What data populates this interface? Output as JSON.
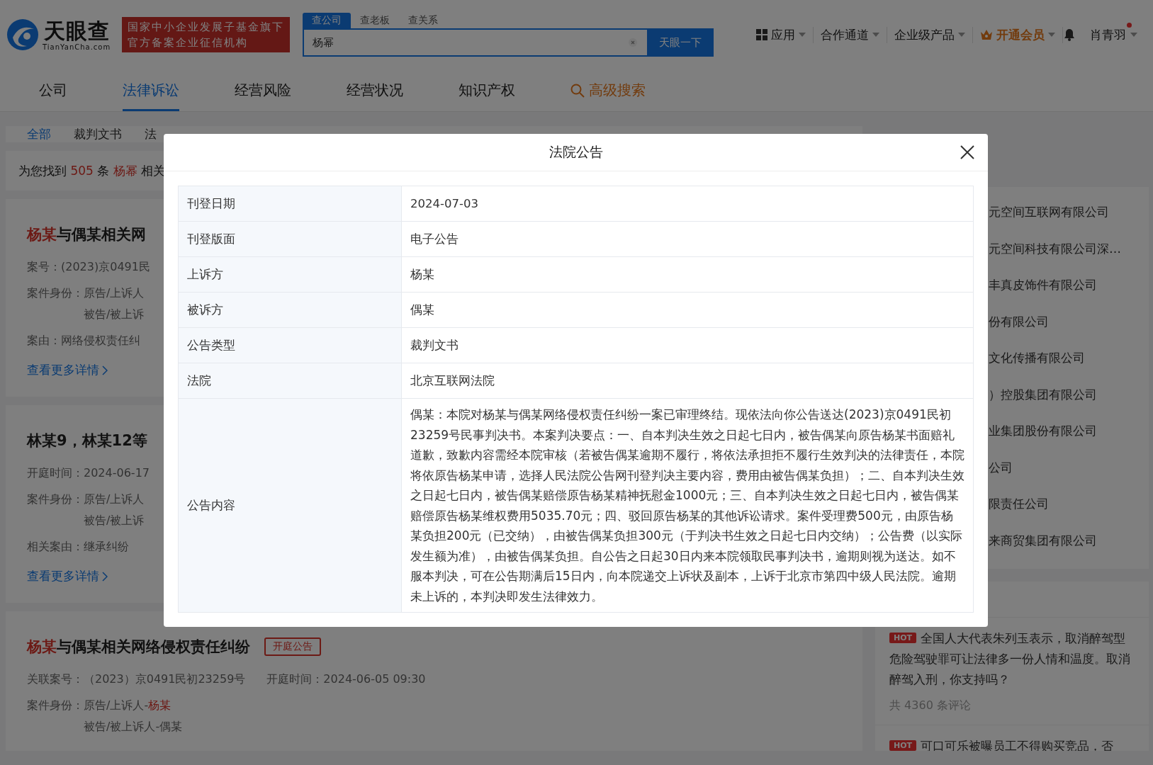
{
  "header": {
    "logo_text": "天眼查",
    "logo_sub": "TianYanCha.com",
    "banner_lines": [
      "国家中小企业发展子基金旗下",
      "官方备案企业征信机构"
    ],
    "search_tabs": [
      {
        "label": "查公司",
        "selected": true
      },
      {
        "label": "查老板",
        "selected": false
      },
      {
        "label": "查关系",
        "selected": false
      }
    ],
    "search_value": "杨幂",
    "search_button": "天眼一下",
    "menu": [
      {
        "label": "应用",
        "kind": "apps"
      },
      {
        "label": "合作通道",
        "kind": "plain"
      },
      {
        "label": "企业级产品",
        "kind": "plain"
      },
      {
        "label": "开通会员",
        "kind": "vip"
      }
    ],
    "user": "肖青羽"
  },
  "nav_tabs": [
    {
      "label": "公司",
      "selected": false,
      "kind": "tab"
    },
    {
      "label": "法律诉讼",
      "selected": true,
      "kind": "tab"
    },
    {
      "label": "经营风险",
      "selected": false,
      "kind": "tab"
    },
    {
      "label": "经营状况",
      "selected": false,
      "kind": "tab"
    },
    {
      "label": "知识产权",
      "selected": false,
      "kind": "tab"
    },
    {
      "label": "高级搜索",
      "selected": false,
      "kind": "search"
    }
  ],
  "filter_tabs": [
    {
      "label": "全部",
      "selected": true
    },
    {
      "label": "裁判文书",
      "selected": false
    },
    {
      "label": "法",
      "selected": false
    }
  ],
  "result_summary": {
    "prefix": "为您找到",
    "count": "505",
    "unit": "条",
    "keyword": "杨幂",
    "suffix": "相关"
  },
  "results": [
    {
      "title_highlight": "杨某",
      "title": "与偶某相关网",
      "rows": [
        [
          {
            "label": "案号：",
            "lines": [
              {
                "text": "(2023)京0491民"
              }
            ]
          }
        ],
        [
          {
            "label": "案件身份：",
            "lines": [
              {
                "text": "原告/上诉人"
              },
              {
                "text": "被告/被上诉"
              }
            ]
          }
        ],
        [
          {
            "label": "案由：",
            "lines": [
              {
                "text": "网络侵权责任纠"
              }
            ]
          }
        ]
      ],
      "more": "查看更多详情"
    },
    {
      "title": "林某9，林某12等",
      "rows": [
        [
          {
            "label": "开庭时间：",
            "lines": [
              {
                "text": "2024-06-17"
              }
            ]
          }
        ],
        [
          {
            "label": "案件身份：",
            "lines": [
              {
                "text": "原告/上诉人"
              },
              {
                "text": "被告/被上诉"
              }
            ]
          }
        ],
        [
          {
            "label": "相关案由：",
            "lines": [
              {
                "text": "继承纠纷"
              }
            ]
          }
        ]
      ],
      "more": "查看更多详情"
    },
    {
      "title_highlight": "杨某",
      "title": "与偶某相关网络侵权责任纠纷",
      "tag": "开庭公告",
      "rows": [
        [
          {
            "label": "关联案号：",
            "lines": [
              {
                "text": "（2023）京0491民初23259号"
              }
            ]
          },
          {
            "label": "开庭时间：",
            "lines": [
              {
                "text": "2024-06-05 09:30"
              }
            ]
          }
        ],
        [
          {
            "label": "案件身份：",
            "lines": [
              {
                "text": "原告/上诉人-",
                "highlight": "杨某"
              },
              {
                "text": "被告/被上诉人-偶某"
              }
            ]
          }
        ]
      ]
    }
  ],
  "side": {
    "companies": [
      "元空间互联网有限公司",
      "元空间科技有限公司深…",
      "丰真皮饰件有限公司",
      "份有限公司",
      "文化传播有限公司",
      "）控股集团有限公司",
      "业集团股份有限公司",
      "公司",
      "限责任公司",
      "来商贸集团有限公司"
    ],
    "hot_news": [
      {
        "badge": "HOT",
        "text": "全国人大代表朱列玉表示，取消醉驾型危险驾驶罪可让法律多一份人情和温度。取消醉驾入刑，你支持吗？",
        "comments": "共 4360 条评论"
      },
      {
        "badge": "HOT",
        "text": "可口可乐被曝员工不得购买竞品，否"
      }
    ]
  },
  "modal": {
    "title": "法院公告",
    "rows": [
      {
        "label": "刊登日期",
        "value": "2024-07-03"
      },
      {
        "label": "刊登版面",
        "value": "电子公告"
      },
      {
        "label": "上诉方",
        "value": "杨某"
      },
      {
        "label": "被诉方",
        "value": "偶某"
      },
      {
        "label": "公告类型",
        "value": "裁判文书"
      },
      {
        "label": "法院",
        "value": "北京互联网法院"
      },
      {
        "label": "公告内容",
        "value": "偶某：本院对杨某与偶某网络侵权责任纠纷一案已审理终结。现依法向你公告送达(2023)京0491民初23259号民事判决书。本案判决要点：一、自本判决生效之日起七日内，被告偶某向原告杨某书面赔礼道歉，致歉内容需经本院审核（若被告偶某逾期不履行，将依法承担拒不履行生效判决的法律责任，本院将依原告杨某申请，选择人民法院公告网刊登判决主要内容，费用由被告偶某负担）；二、自本判决生效之日起七日内，被告偶某赔偿原告杨某精神抚慰金1000元；三、自本判决生效之日起七日内，被告偶某赔偿原告杨某维权费用5035.70元；四、驳回原告杨某的其他诉讼请求。案件受理费500元，由原告杨某负担200元（已交纳），由被告偶某负担300元（于判决书生效之日起七日内交纳）；公告费（以实际发生额为准），由被告偶某负担。自公告之日起30日内来本院领取民事判决书，逾期则视为送达。如不服本判决，可在公告期满后15日内，向本院递交上诉状及副本，上诉于北京市第四中级人民法院。逾期未上诉的，本判决即发生法律效力。"
      }
    ]
  }
}
